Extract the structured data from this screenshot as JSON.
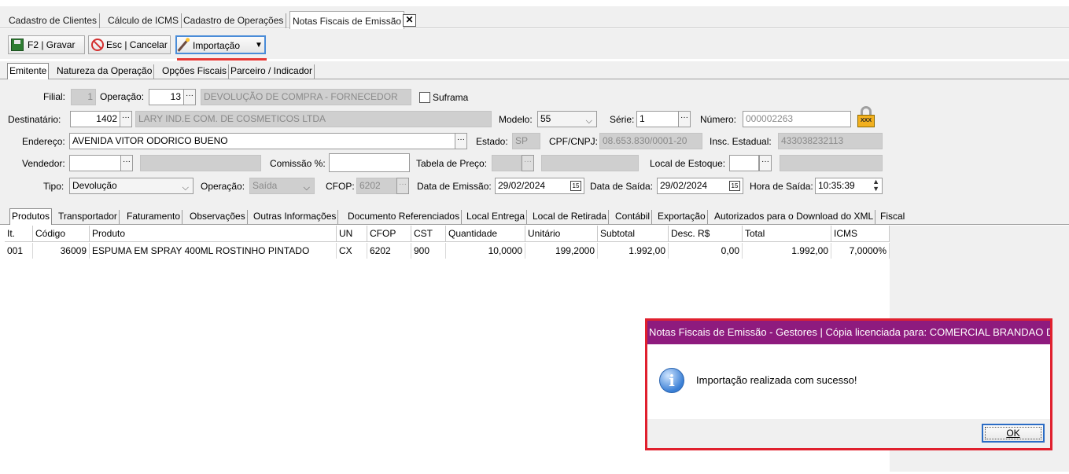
{
  "doc_tabs": [
    "Cadastro de Clientes",
    "Cálculo de ICMS",
    "Cadastro de Operações",
    "Notas Fiscais de Emissão"
  ],
  "toolbar": {
    "save": "F2 | Gravar",
    "cancel": "Esc | Cancelar",
    "import": "Importação"
  },
  "sections": [
    "Emitente",
    "Natureza da Operação",
    "Opções Fiscais",
    "Parceiro / Indicador"
  ],
  "form": {
    "filial_label": "Filial:",
    "filial": "1",
    "operacao_label": "Operação:",
    "operacao": "13",
    "operacao_desc": "DEVOLUÇÃO DE COMPRA - FORNECEDOR",
    "suframa_label": "Suframa",
    "destinatario_label": "Destinatário:",
    "destinatario": "1402",
    "destinatario_desc": "LARY IND.E COM. DE COSMETICOS LTDA",
    "modelo_label": "Modelo:",
    "modelo": "55",
    "serie_label": "Série:",
    "serie": "1",
    "numero_label": "Número:",
    "numero": "000002263",
    "endereco_label": "Endereço:",
    "endereco": "AVENIDA VITOR ODORICO BUENO",
    "estado_label": "Estado:",
    "estado": "SP",
    "cnpj_label": "CPF/CNPJ:",
    "cnpj": "08.653.830/0001-20",
    "ie_label": "Insc. Estadual:",
    "ie": "433038232113",
    "vendedor_label": "Vendedor:",
    "comissao_label": "Comissão %:",
    "tabela_label": "Tabela de Preço:",
    "estoque_label": "Local de Estoque:",
    "tipo_label": "Tipo:",
    "tipo": "Devolução",
    "operacao2_label": "Operação:",
    "operacao2": "Saída",
    "cfop_label": "CFOP:",
    "cfop": "6202",
    "emissao_label": "Data de Emissão:",
    "emissao": "29/02/2024",
    "saida_label": "Data de Saída:",
    "saida": "29/02/2024",
    "hora_label": "Hora de Saída:",
    "hora": "10:35:39"
  },
  "bottom_tabs": [
    "Produtos",
    "Transportador",
    "Faturamento",
    "Observações",
    "Outras Informações",
    "Documento Referenciados",
    "Local Entrega",
    "Local de Retirada",
    "Contábil",
    "Exportação",
    "Autorizados para o Download do XML",
    "Fiscal"
  ],
  "grid": {
    "columns": [
      "It.",
      "Código",
      "Produto",
      "UN",
      "CFOP",
      "CST",
      "Quantidade",
      "Unitário",
      "Subtotal",
      "Desc. R$",
      "Total",
      "ICMS"
    ],
    "rows": [
      [
        "001",
        "36009",
        "ESPUMA EM SPRAY 400ML ROSTINHO PINTADO",
        "CX",
        "6202",
        "900",
        "10,0000",
        "199,2000",
        "1.992,00",
        "0,00",
        "1.992,00",
        "7,0000%"
      ]
    ]
  },
  "dialog": {
    "title": "Notas Fiscais de Emissão - Gestores | Cópia licenciada para: COMERCIAL BRANDAO D...",
    "message": "Importação realizada com sucesso!",
    "ok": "OK"
  },
  "colors": {
    "dialog_title": "#8e1b7e",
    "highlight": "#e53935",
    "focus": "#2b6cc4"
  },
  "icons": {
    "save": "floppy-disk-icon",
    "cancel": "stop-sign-icon",
    "import": "magic-wand-icon",
    "lock": "padlock-icon",
    "info": "info-icon"
  }
}
